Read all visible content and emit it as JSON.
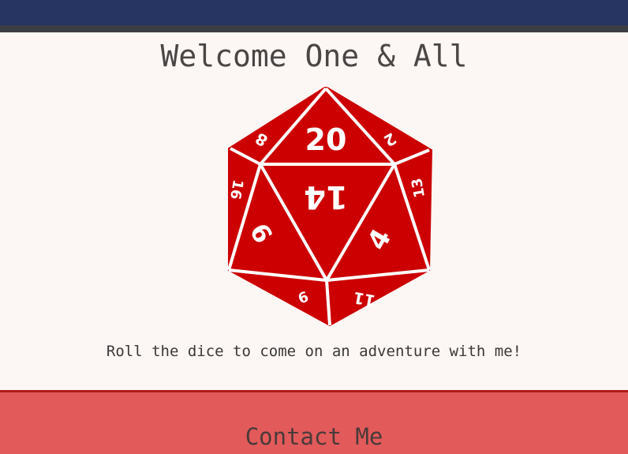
{
  "header": {
    "accent_color": "#263562"
  },
  "hero": {
    "title": "Welcome One & All",
    "tagline": "Roll the dice to come on an adventure with me!",
    "dice": {
      "icon": "d20-dice-icon",
      "color": "#cc0000",
      "faces": [
        "20",
        "14",
        "8",
        "2",
        "16",
        "13",
        "6",
        "4",
        "9",
        "11"
      ]
    }
  },
  "contact": {
    "title": "Contact Me",
    "background": "#e25a5a"
  }
}
